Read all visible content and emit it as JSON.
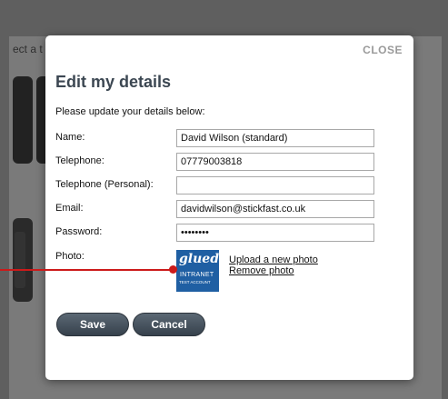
{
  "background": {
    "partial_text": "ect a t"
  },
  "modal": {
    "close_label": "CLOSE",
    "title": "Edit my details",
    "intro": "Please update your details below:",
    "fields": {
      "name": {
        "label": "Name:",
        "value": "David Wilson (standard)"
      },
      "telephone": {
        "label": "Telephone:",
        "value": "07779003818"
      },
      "telephone_personal": {
        "label": "Telephone (Personal):",
        "value": ""
      },
      "email": {
        "label": "Email:",
        "value": "davidwilson@stickfast.co.uk"
      },
      "password": {
        "label": "Password:",
        "value": "••••••••"
      }
    },
    "photo": {
      "label": "Photo:",
      "thumb_logo": "glued.",
      "thumb_line1": "INTRANET",
      "thumb_line2": "TEST ACCOUNT",
      "upload_link": "Upload a new photo",
      "remove_link": "Remove photo"
    },
    "buttons": {
      "save": "Save",
      "cancel": "Cancel"
    }
  },
  "colors": {
    "accent_pointer": "#cc1a1a",
    "button": "#3f4a55",
    "title": "#3c4752"
  }
}
